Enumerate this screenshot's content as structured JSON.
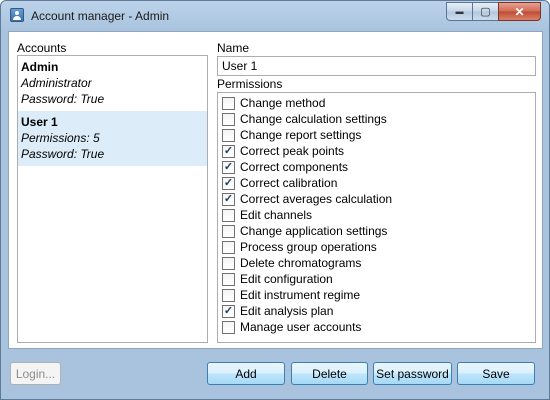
{
  "window": {
    "title": "Account manager - Admin",
    "caption_min": "▬",
    "caption_max": "▢",
    "caption_close": "✕"
  },
  "accounts": {
    "label": "Accounts",
    "items": [
      {
        "name": "Admin",
        "line1": "Administrator",
        "line2": "Password: True",
        "selected": false
      },
      {
        "name": "User 1",
        "line1": "Permissions: 5",
        "line2": "Password: True",
        "selected": true
      }
    ]
  },
  "name": {
    "label": "Name",
    "value": "User 1"
  },
  "permissions": {
    "label": "Permissions",
    "items": [
      {
        "label": "Change method",
        "checked": false
      },
      {
        "label": "Change calculation settings",
        "checked": false
      },
      {
        "label": "Change report settings",
        "checked": false
      },
      {
        "label": "Correct peak points",
        "checked": true
      },
      {
        "label": "Correct components",
        "checked": true
      },
      {
        "label": "Correct calibration",
        "checked": true
      },
      {
        "label": "Correct averages calculation",
        "checked": true
      },
      {
        "label": "Edit channels",
        "checked": false
      },
      {
        "label": "Change application settings",
        "checked": false
      },
      {
        "label": "Process group operations",
        "checked": false
      },
      {
        "label": "Delete chromatograms",
        "checked": false
      },
      {
        "label": "Edit configuration",
        "checked": false
      },
      {
        "label": "Edit instrument regime",
        "checked": false
      },
      {
        "label": "Edit analysis plan",
        "checked": true
      },
      {
        "label": "Manage user accounts",
        "checked": false
      }
    ]
  },
  "buttons": {
    "login": "Login...",
    "add": "Add",
    "delete": "Delete",
    "set_password": "Set password",
    "save": "Save"
  }
}
